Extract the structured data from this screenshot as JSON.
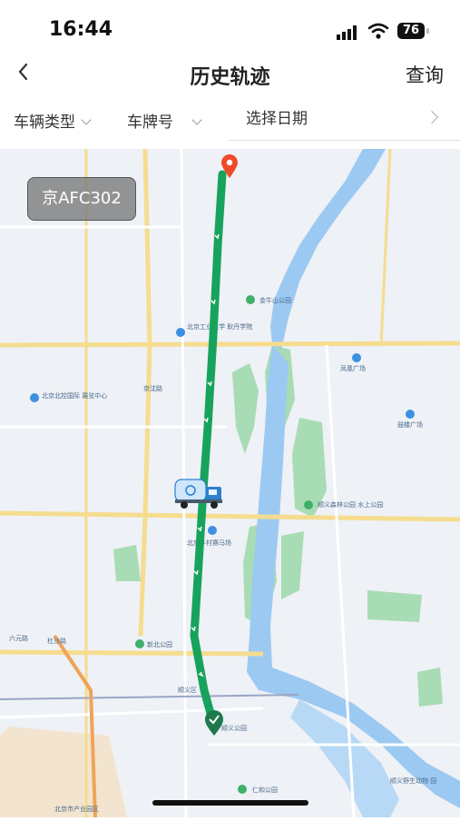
{
  "status": {
    "time": "16:44",
    "battery": "76"
  },
  "nav": {
    "back_icon": "chevron-left-icon",
    "title": "历史轨迹",
    "query_label": "查询"
  },
  "filters": {
    "vehicle_type": "车辆类型",
    "plate_no": "车牌号",
    "date": "选择日期"
  },
  "map": {
    "plate_label": "京AFC302",
    "poi_1": "北京工业大学 耿丹学院",
    "poi_2": "北京北控国际 展览中心",
    "poi_3": "凤凰广场",
    "poi_4": "鼓楼广场",
    "poi_5": "金牛山公园",
    "poi_6": "顺义森林公园 水上公园",
    "poi_7": "北京乡村赛马场",
    "poi_8": "新北公园",
    "poi_9": "顺义公园",
    "poi_10": "仁和公园",
    "poi_11": "京沈路",
    "poi_12": "顺义区",
    "poi_13": "杜沙路",
    "poi_14": "北京市产业园区",
    "poi_15": "六元路",
    "poi_16": "顺义野生动物 园",
    "start_color": "#1e7a4c",
    "end_color": "#ef4b2b",
    "route_color": "#17a35b"
  },
  "home_indicator": ""
}
